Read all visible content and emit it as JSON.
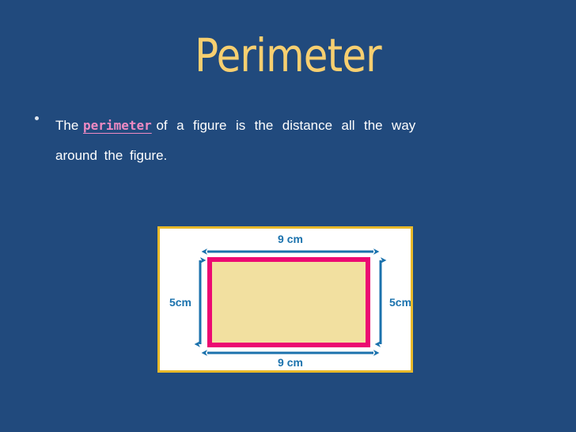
{
  "slide": {
    "title": "Perimeter",
    "background_color": "#214a7d",
    "title_color": "#f7cf70"
  },
  "body": {
    "bullet_marker": "•",
    "line1_lead": "The ",
    "keyword": "perimeter",
    "keyword_color": "#ef8ac2",
    "line1_tail": " of  a  figure  is  the  distance  all  the  way",
    "line2": "around  the  figure."
  },
  "figure": {
    "panel_border_color": "#e8b92a",
    "panel_background": "#ffffff",
    "rect_fill": "#f2e0a0",
    "rect_stroke": "#ec0a72",
    "arrow_color": "#1b72ad",
    "labels": {
      "top": "9 cm",
      "bottom": "9 cm",
      "left": "5cm",
      "right": "5cm"
    }
  }
}
